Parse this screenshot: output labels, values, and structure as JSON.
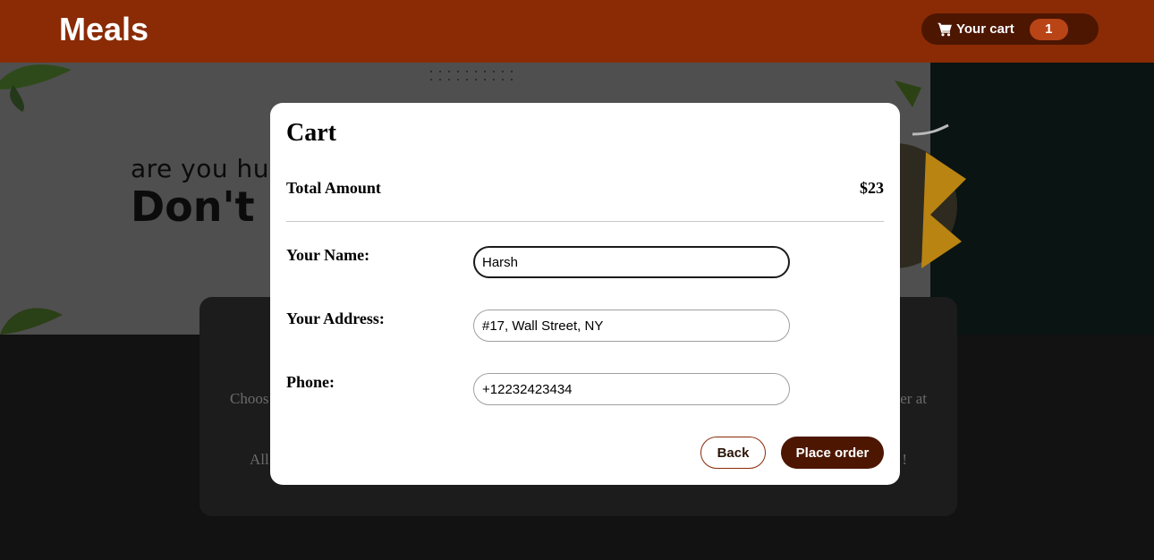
{
  "header": {
    "brand": "Meals",
    "cart_label": "Your cart",
    "cart_count": "1"
  },
  "hero": {
    "tagline": "are you hun",
    "headline": "Don't W"
  },
  "summary": {
    "line1_left": "Choos",
    "line1_right": "er at",
    "line2_left": "All",
    "line2_right": "!"
  },
  "modal": {
    "title": "Cart",
    "total_label": "Total Amount",
    "total_value": "$23",
    "fields": [
      {
        "label": "Your Name:",
        "value": "Harsh"
      },
      {
        "label": "Your Address:",
        "value": "#17, Wall Street, NY"
      },
      {
        "label": "Phone:",
        "value": "+12232423434"
      }
    ],
    "back_label": "Back",
    "order_label": "Place order"
  },
  "icons": {
    "cart": "shopping-cart-icon"
  },
  "colors": {
    "header_bg": "#8a2b06",
    "accent_dark": "#4d1601",
    "badge_bg": "#b94517"
  }
}
